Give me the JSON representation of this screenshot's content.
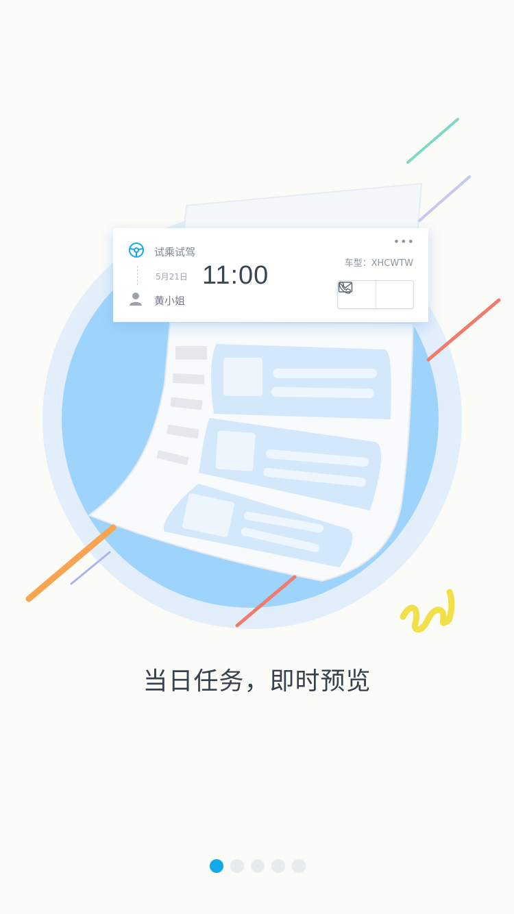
{
  "task_card": {
    "task_type": "试乘试驾",
    "date": "5月21日",
    "time": "11:00",
    "customer_name": "黄小姐",
    "model_label": "车型：XHCWTW",
    "more_label": "•••",
    "icons": {
      "task": "steering-wheel-icon",
      "customer": "person-icon",
      "message": "mail-icon",
      "call": "phone-icon"
    }
  },
  "headline": "当日任务，即时预览",
  "pagination": {
    "total": 5,
    "active_index": 0,
    "active_color": "#10a9ea",
    "inactive_color": "#e8ebeb"
  },
  "colors": {
    "accent": "#10a9ea",
    "circle_main": "#9ed4fb",
    "circle_halo": "#e2effb",
    "background": "#fbfbf8"
  }
}
